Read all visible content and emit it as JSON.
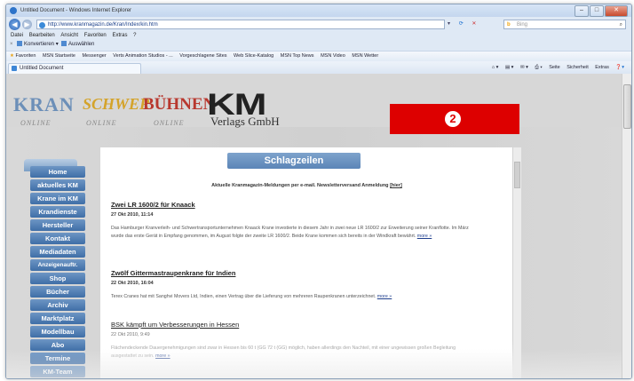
{
  "browser": {
    "window_title": "Untitled Document - Windows Internet Explorer",
    "address": "http://www.kranmagazin.de/Kran/Index/kin.htm",
    "search_placeholder": "Bing",
    "menu": [
      "Datei",
      "Bearbeiten",
      "Ansicht",
      "Favoriten",
      "Extras",
      "?"
    ],
    "commands": {
      "convert": "Konvertieren",
      "select": "Auswählen"
    },
    "favorites": [
      "Favoriten",
      "MSN Startseite",
      "Messenger",
      "Verts Animation Studios - ...",
      "Vorgeschlagene Sites",
      "Web Slice-Katalog",
      "MSN Top News",
      "MSN Video",
      "MSN Wetter"
    ],
    "tab_title": "Untitled Document",
    "tab_tools": [
      "Seite",
      "Sicherheit",
      "Extras"
    ]
  },
  "header": {
    "logos": {
      "kran": "KRAN",
      "schwer": "SCHWER",
      "buehnen": "BÜHNEN",
      "km": "KM",
      "verlag": "Verlags GmbH",
      "online": "ONLINE"
    },
    "badge": "2"
  },
  "sidebar": {
    "items": [
      "Home",
      "aktuelles KM",
      "Krane im KM",
      "Krandienste",
      "Hersteller",
      "Kontakt",
      "Mediadaten",
      "Anzeigenauftr.",
      "Shop",
      "Bücher",
      "Archiv",
      "Marktplatz",
      "Modellbau",
      "Abo",
      "Termine",
      "KM-Team"
    ]
  },
  "main": {
    "headline": "Schlagzeilen",
    "newsletter": "Aktuelle Kranmagazin-Meldungen per e-mail. Newsletterversand Anmeldung",
    "newsletter_link": "[hier]",
    "more_label": "more »",
    "news": [
      {
        "title": "Zwei LR 1600/2 für Knaack",
        "date": "27 Okt 2010, 11:14",
        "text": "Das Hamburger Kranverleih- und Schwertransportunternehmen Knaack Krane investierte in diesem Jahr in zwei neue LR 1600/2 zur Erweiterung seiner Kranflotte. Im März wurde das erste Gerät in Empfang genommen, im August folgte der zweite LR 1600/2. Beide Krane kommen sich bereits in der Windkraft bewährt."
      },
      {
        "title": "Zwölf Gittermastraupenkrane für Indien",
        "date": "22 Okt 2010, 16:04",
        "text": "Terex Cranes hat mit Sanghvi Movers Ltd, Indien, einen Vertrag über die Lieferung von mehreren Raupenkranen unterzeichnet."
      },
      {
        "title": "BSK kämpft um Verbesserungen in Hessen",
        "date": "22 Okt 2010, 9:49",
        "text": "Flächendeckende Dauergenehmigungen sind zwar in Hessen bis 60 t (GG 72 t (GG) möglich, haben allerdings den Nachteil, mit einer ungewissen großen Begleitung ausgestattet zu sein."
      }
    ]
  }
}
